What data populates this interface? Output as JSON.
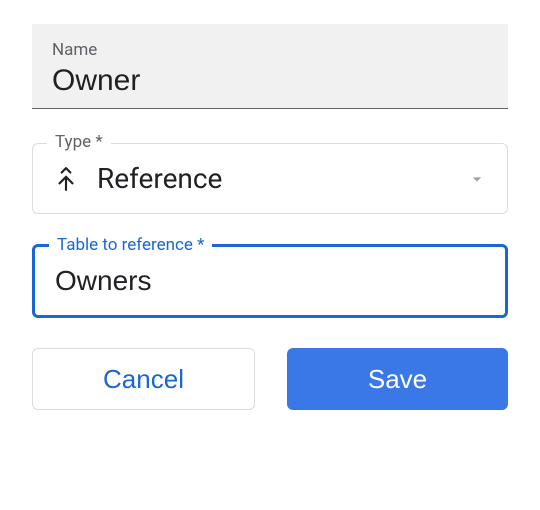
{
  "nameField": {
    "label": "Name",
    "value": "Owner"
  },
  "typeField": {
    "label": "Type *",
    "value": "Reference",
    "icon": "merge-icon"
  },
  "referenceField": {
    "label": "Table to reference *",
    "value": "Owners"
  },
  "buttons": {
    "cancel": "Cancel",
    "save": "Save"
  }
}
